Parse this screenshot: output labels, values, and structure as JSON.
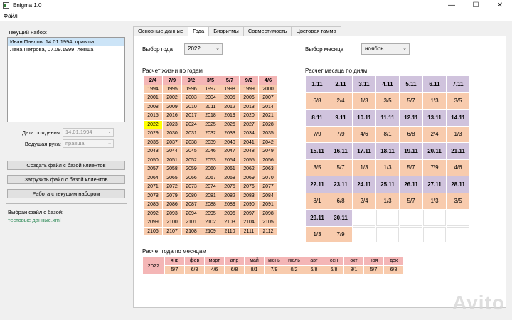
{
  "window": {
    "title": "Enigma 1.0"
  },
  "menu": [
    "Файл"
  ],
  "left": {
    "current_set_label": "Текущий набор:",
    "clients": [
      "Иван Павлов, 14.01.1994, правша",
      "Лена Петрова, 07.09.1999, левша"
    ],
    "selected_index": 0,
    "birth_date_label": "Дата рождения:",
    "birth_date_value": "14.01.1994",
    "hand_label": "Ведущая рука:",
    "hand_value": "правша",
    "btn_create": "Создать файл с базой клиентов",
    "btn_load": "Загрузить файл с базой клиентов",
    "btn_work": "Работа с текущим набором",
    "selected_file_label": "Выбран файл с базой:",
    "selected_file_value": "тестовые данные.xml"
  },
  "tabs": [
    "Основные данные",
    "Года",
    "Биоритмы",
    "Совместимость",
    "Цветовая гамма"
  ],
  "active_tab": 1,
  "year": {
    "label": "Выбор года",
    "value": "2022"
  },
  "month": {
    "label": "Выбор месяца",
    "value": "ноябрь"
  },
  "life_calc": {
    "title": "Расчет жизни по годам",
    "headers": [
      "2/4",
      "7/9",
      "9/2",
      "3/5",
      "5/7",
      "9/2",
      "4/6"
    ],
    "current_year": "2022",
    "rows": [
      [
        "1994",
        "1995",
        "1996",
        "1997",
        "1998",
        "1999",
        "2000"
      ],
      [
        "2001",
        "2002",
        "2003",
        "2004",
        "2005",
        "2006",
        "2007"
      ],
      [
        "2008",
        "2009",
        "2010",
        "2011",
        "2012",
        "2013",
        "2014"
      ],
      [
        "2015",
        "2016",
        "2017",
        "2018",
        "2019",
        "2020",
        "2021"
      ],
      [
        "2022",
        "2023",
        "2024",
        "2025",
        "2026",
        "2027",
        "2028"
      ],
      [
        "2029",
        "2030",
        "2031",
        "2032",
        "2033",
        "2034",
        "2035"
      ],
      [
        "2036",
        "2037",
        "2038",
        "2039",
        "2040",
        "2041",
        "2042"
      ],
      [
        "2043",
        "2044",
        "2045",
        "2046",
        "2047",
        "2048",
        "2049"
      ],
      [
        "2050",
        "2051",
        "2052",
        "2053",
        "2054",
        "2055",
        "2056"
      ],
      [
        "2057",
        "2058",
        "2059",
        "2060",
        "2061",
        "2062",
        "2063"
      ],
      [
        "2064",
        "2065",
        "2066",
        "2067",
        "2068",
        "2069",
        "2070"
      ],
      [
        "2071",
        "2072",
        "2073",
        "2074",
        "2075",
        "2076",
        "2077"
      ],
      [
        "2078",
        "2079",
        "2080",
        "2081",
        "2082",
        "2083",
        "2084"
      ],
      [
        "2085",
        "2086",
        "2087",
        "2088",
        "2089",
        "2090",
        "2091"
      ],
      [
        "2092",
        "2093",
        "2094",
        "2095",
        "2096",
        "2097",
        "2098"
      ],
      [
        "2099",
        "2100",
        "2101",
        "2102",
        "2103",
        "2104",
        "2105"
      ],
      [
        "2106",
        "2107",
        "2108",
        "2109",
        "2110",
        "2111",
        "2112"
      ]
    ]
  },
  "month_calc": {
    "title": "Расчет месяца по дням",
    "weeks": [
      {
        "dates": [
          "1.11",
          "2.11",
          "3.11",
          "4.11",
          "5.11",
          "6.11",
          "7.11"
        ],
        "values": [
          "6/8",
          "2/4",
          "1/3",
          "3/5",
          "5/7",
          "1/3",
          "3/5"
        ]
      },
      {
        "dates": [
          "8.11",
          "9.11",
          "10.11",
          "11.11",
          "12.11",
          "13.11",
          "14.11"
        ],
        "values": [
          "7/9",
          "7/9",
          "4/6",
          "8/1",
          "6/8",
          "2/4",
          "1/3"
        ]
      },
      {
        "dates": [
          "15.11",
          "16.11",
          "17.11",
          "18.11",
          "19.11",
          "20.11",
          "21.11"
        ],
        "values": [
          "3/5",
          "5/7",
          "1/3",
          "1/3",
          "5/7",
          "7/9",
          "4/6"
        ]
      },
      {
        "dates": [
          "22.11",
          "23.11",
          "24.11",
          "25.11",
          "26.11",
          "27.11",
          "28.11"
        ],
        "values": [
          "8/1",
          "6/8",
          "2/4",
          "1/3",
          "5/7",
          "1/3",
          "3/5"
        ]
      },
      {
        "dates": [
          "29.11",
          "30.11",
          "",
          "",
          "",
          "",
          ""
        ],
        "values": [
          "1/3",
          "7/9",
          "",
          "",
          "",
          "",
          ""
        ]
      }
    ]
  },
  "year_calc": {
    "title": "Расчет года по месяцам",
    "year": "2022",
    "months": [
      "янв",
      "фев",
      "март",
      "апр",
      "май",
      "июнь",
      "июль",
      "авг",
      "сен",
      "окт",
      "ноя",
      "дек"
    ],
    "values": [
      "5/7",
      "6/8",
      "4/6",
      "6/8",
      "8/1",
      "7/9",
      "0/2",
      "6/8",
      "6/8",
      "8/1",
      "5/7",
      "6/8"
    ]
  },
  "watermark": "Avito"
}
